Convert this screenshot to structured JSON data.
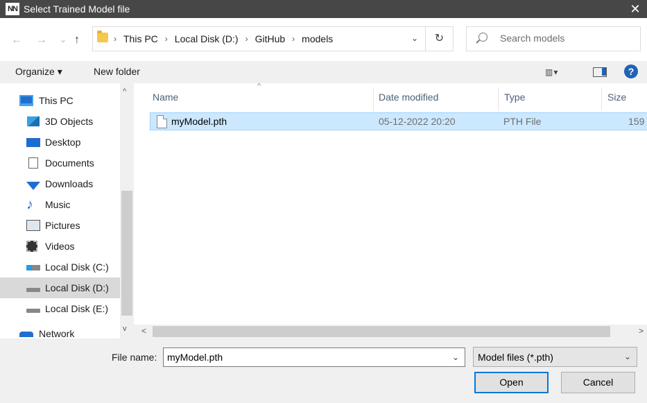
{
  "window": {
    "title": "Select Trained Model file",
    "app_icon_text": "NN",
    "close_glyph": "✕"
  },
  "nav": {
    "back_glyph": "←",
    "forward_glyph": "→",
    "recent_glyph": "⌄",
    "up_glyph": "↑"
  },
  "address": {
    "path": [
      "This PC",
      "Local Disk (D:)",
      "GitHub",
      "models"
    ],
    "separator": "›",
    "dropdown_glyph": "⌄",
    "refresh_glyph": "↻"
  },
  "search": {
    "placeholder": "Search models"
  },
  "commands": {
    "organize": "Organize ▾",
    "new_folder": "New folder",
    "view_glyph": "▥▾",
    "help_glyph": "?"
  },
  "sidebar": {
    "items": [
      {
        "label": "This PC",
        "icon": "computer-icon"
      },
      {
        "label": "3D Objects",
        "icon": "3d-objects-icon"
      },
      {
        "label": "Desktop",
        "icon": "desktop-icon"
      },
      {
        "label": "Documents",
        "icon": "documents-icon"
      },
      {
        "label": "Downloads",
        "icon": "downloads-icon"
      },
      {
        "label": "Music",
        "icon": "music-icon"
      },
      {
        "label": "Pictures",
        "icon": "pictures-icon"
      },
      {
        "label": "Videos",
        "icon": "videos-icon"
      },
      {
        "label": "Local Disk (C:)",
        "icon": "drive-icon"
      },
      {
        "label": "Local Disk (D:)",
        "icon": "drive-icon",
        "selected": true
      },
      {
        "label": "Local Disk (E:)",
        "icon": "drive-icon"
      },
      {
        "label": "Network",
        "icon": "network-icon"
      }
    ],
    "scroll_up_glyph": "^",
    "scroll_down_glyph": "v"
  },
  "file_list": {
    "columns": [
      "Name",
      "Date modified",
      "Type",
      "Size"
    ],
    "sort_glyph": "^",
    "rows": [
      {
        "name": "myModel.pth",
        "date": "05-12-2022 20:20",
        "type": "PTH File",
        "size": "159"
      }
    ]
  },
  "hscroll": {
    "left_glyph": "<",
    "right_glyph": ">"
  },
  "footer": {
    "file_name_label": "File name:",
    "file_name_value": "myModel.pth",
    "file_name_dropdown_glyph": "⌄",
    "file_type_value": "Model files (*.pth)",
    "file_type_dropdown_glyph": "⌄",
    "open_label": "Open",
    "cancel_label": "Cancel"
  },
  "colors": {
    "titlebar": "#474747",
    "selection": "#cce8ff",
    "accent": "#0078d7",
    "folder": "#f5c74a"
  }
}
